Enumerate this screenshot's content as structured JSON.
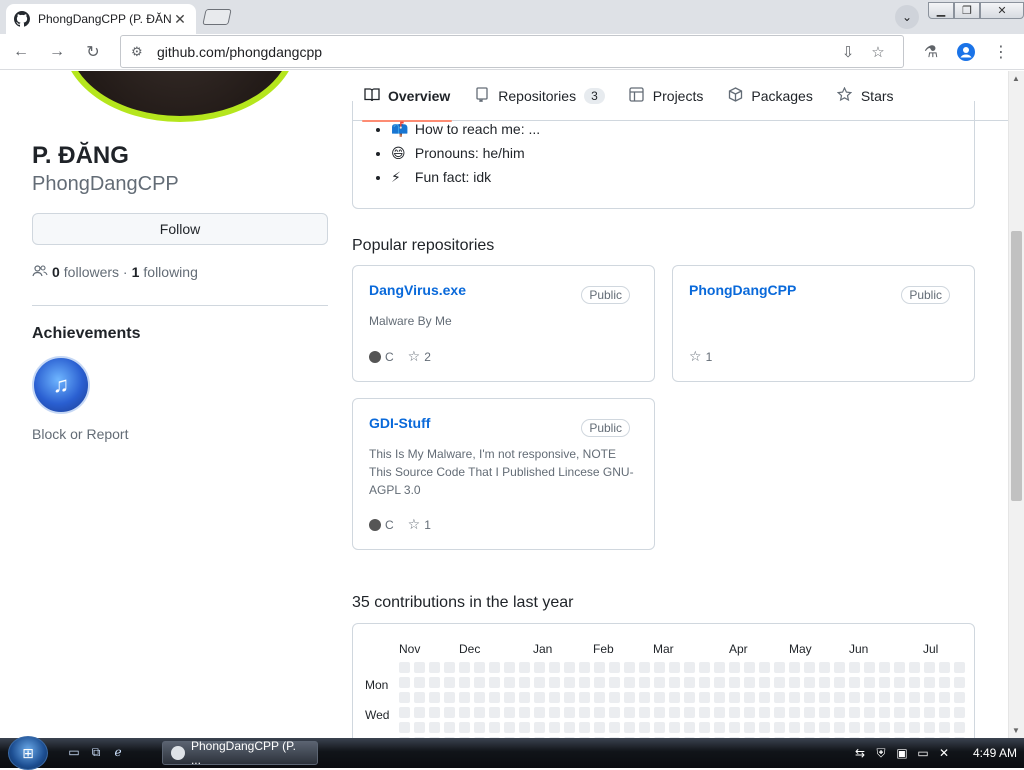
{
  "browser": {
    "tab_title": "PhongDangCPP (P. ĐĂNG)",
    "tab_close": "✕",
    "tab_menu_glyph": "⌄",
    "url": "github.com/phongdangcpp"
  },
  "nav": {
    "items": [
      {
        "label": "Overview",
        "icon": "book-icon",
        "glyph": "📖"
      },
      {
        "label": "Repositories",
        "icon": "repo-icon",
        "glyph": "▯",
        "count": "3"
      },
      {
        "label": "Projects",
        "icon": "table-icon",
        "glyph": "▦"
      },
      {
        "label": "Packages",
        "icon": "package-icon",
        "glyph": "⬡"
      },
      {
        "label": "Stars",
        "icon": "star-icon",
        "glyph": "☆"
      }
    ]
  },
  "profile": {
    "fullname": "P. ĐĂNG",
    "username": "PhongDangCPP",
    "follow_label": "Follow",
    "followers_count": "0",
    "followers_label": "followers ·",
    "following_count": "1",
    "following_label": "following",
    "achievements_title": "Achievements",
    "block_report": "Block or Report"
  },
  "readme": {
    "items": [
      {
        "emoji": "📫",
        "text": "How to reach me: ..."
      },
      {
        "emoji": "😄",
        "text": "Pronouns: he/him"
      },
      {
        "emoji": "⚡",
        "text": "Fun fact: idk"
      }
    ]
  },
  "popular": {
    "title": "Popular repositories",
    "repos": [
      {
        "name": "DangVirus.exe",
        "visibility": "Public",
        "description": "Malware By Me",
        "language": "C",
        "stars": "2"
      },
      {
        "name": "PhongDangCPP",
        "visibility": "Public",
        "description": "",
        "language": "",
        "stars": "1"
      },
      {
        "name": "GDI-Stuff",
        "visibility": "Public",
        "description": "This Is My Malware, I'm not responsive, NOTE This Source Code That I Published Lincese GNU-AGPL 3.0",
        "language": "C",
        "stars": "1"
      }
    ]
  },
  "contributions": {
    "title": "35 contributions in the last year",
    "months": [
      "Nov",
      "Dec",
      "Jan",
      "Feb",
      "Mar",
      "Apr",
      "May",
      "Jun",
      "Jul"
    ],
    "day_labels": [
      "Mon",
      "Wed"
    ]
  },
  "taskbar": {
    "task_label": "PhongDangCPP (P. ...",
    "clock": "4:49 AM"
  },
  "colors": {
    "accent_link": "#0969da",
    "nav_underline": "#fd8c73",
    "lang_c": "#555555",
    "avatar_ring": "#b5e61d"
  }
}
